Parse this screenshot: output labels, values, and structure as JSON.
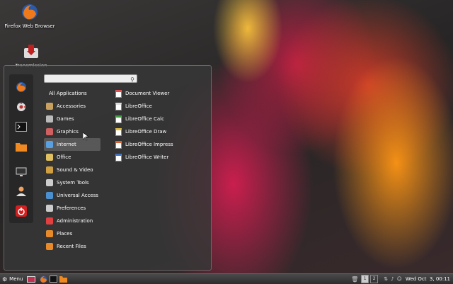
{
  "desktop": {
    "icons": [
      {
        "label": "Firefox Web Browser",
        "icon": "firefox-icon"
      },
      {
        "label": "Transmission",
        "icon": "transmission-icon"
      }
    ]
  },
  "menu": {
    "search_placeholder": "",
    "favorites": [
      "firefox-icon",
      "settings-icon",
      "terminal-icon",
      "folder-icon",
      "monitor-icon",
      "user-icon",
      "power-icon"
    ],
    "all_applications": "All Applications",
    "categories": [
      {
        "label": "Accessories",
        "color": "#c8a060"
      },
      {
        "label": "Games",
        "color": "#bbbbbb"
      },
      {
        "label": "Graphics",
        "color": "#d06060"
      },
      {
        "label": "Internet",
        "color": "#5aa0e0"
      },
      {
        "label": "Office",
        "color": "#e0c060"
      },
      {
        "label": "Sound & Video",
        "color": "#d0a040"
      },
      {
        "label": "System Tools",
        "color": "#cccccc"
      },
      {
        "label": "Universal Access",
        "color": "#4a90d0"
      },
      {
        "label": "Preferences",
        "color": "#cccccc"
      },
      {
        "label": "Administration",
        "color": "#e04040"
      },
      {
        "label": "Places",
        "color": "#e88a2a"
      },
      {
        "label": "Recent Files",
        "color": "#e88a2a"
      }
    ],
    "selected_category": "Internet",
    "apps": [
      {
        "label": "Document Viewer",
        "color": "#e05050"
      },
      {
        "label": "LibreOffice",
        "color": "#dddddd"
      },
      {
        "label": "LibreOffice Calc",
        "color": "#40a040"
      },
      {
        "label": "LibreOffice Draw",
        "color": "#e0c040"
      },
      {
        "label": "LibreOffice Impress",
        "color": "#e06030"
      },
      {
        "label": "LibreOffice Writer",
        "color": "#4070c0"
      }
    ]
  },
  "panel": {
    "menu_label": "Menu",
    "workspaces": [
      "1",
      "2"
    ],
    "clock": "Wed Oct  3, 00:11"
  }
}
